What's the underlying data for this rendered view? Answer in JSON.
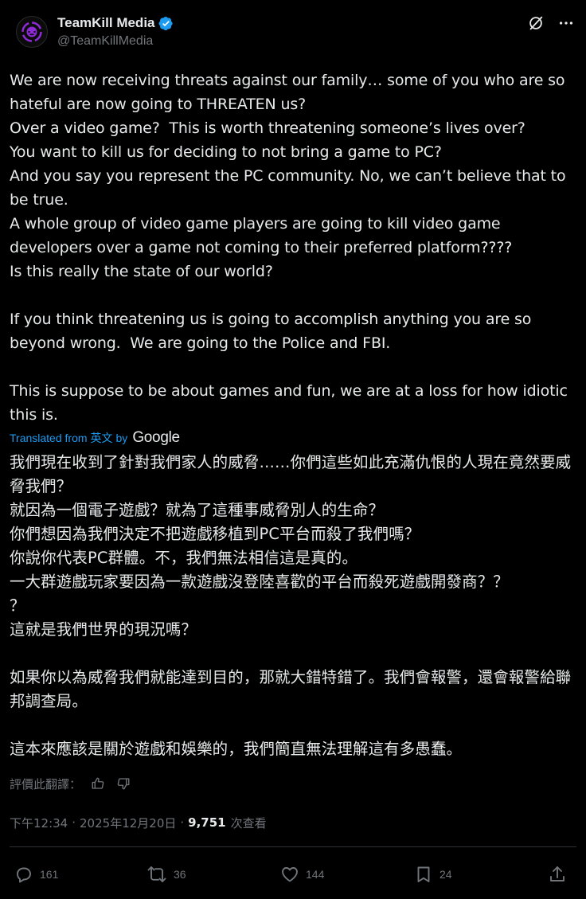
{
  "author": {
    "display_name": "TeamKill Media",
    "handle": "@TeamKillMedia",
    "verified": true,
    "avatar_icon": "teamkill-logo-icon",
    "accent": "#8e2bd6"
  },
  "header_actions": {
    "grok_icon": "grok-icon",
    "more_icon": "more-dots-icon"
  },
  "post": {
    "original_text": "We are now receiving threats against our family… some of you who are so hateful are now going to THREATEN us?\nOver a video game?  This is worth threatening someone’s lives over?\nYou want to kill us for deciding to not bring a game to PC?\nAnd you say you represent the PC community. No, we can’t believe that to be true.\nA whole group of video game players are going to kill video game developers over a game not coming to their preferred platform????\nIs this really the state of our world?\n\nIf you think threatening us is going to accomplish anything you are so beyond wrong.  We are going to the Police and FBI.\n\nThis is suppose to be about games and fun, we are at a loss for how idiotic this is.",
    "translation_label": {
      "prefix": "Translated from",
      "language": "英文",
      "by": "by",
      "provider": "Google"
    },
    "translated_text": "我們現在收到了針對我們家人的威脅……你們這些如此充滿仇恨的人現在竟然要威脅我們？\n就因為一個電子遊戲？就為了這種事威脅別人的生命？\n你們想因為我們決定不把遊戲移植到PC平台而殺了我們嗎？\n你說你代表PC群體。不，我們無法相信這是真的。\n一大群遊戲玩家要因為一款遊戲沒登陸喜歡的平台而殺死遊戲開發商？？\n？\n這就是我們世界的現況嗎？\n\n如果你以為威脅我們就能達到目的，那就大錯特錯了。我們會報警，還會報警給聯邦調查局。\n\n這本來應該是關於遊戲和娛樂的，我們簡直無法理解這有多愚蠢。",
    "rate_translation_label": "評價此翻譯：",
    "time": "下午12:34",
    "separator": "·",
    "date": "2025年12月20日",
    "views_count": "9,751",
    "views_label": "次查看"
  },
  "actions": {
    "replies": "161",
    "reposts": "36",
    "likes": "144",
    "bookmarks": "24"
  },
  "colors": {
    "background": "#000000",
    "text": "#e7e9ea",
    "muted": "#71767b",
    "link": "#1d9bf0",
    "verified": "#1d9bf0",
    "divider": "#2f3336"
  }
}
